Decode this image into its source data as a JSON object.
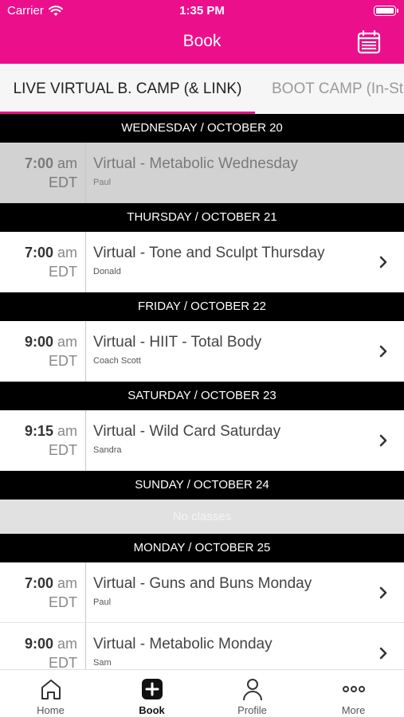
{
  "status_bar": {
    "carrier": "Carrier",
    "time": "1:35 PM"
  },
  "header": {
    "title": "Book",
    "calendar_icon": "calendar-icon"
  },
  "tabs": [
    {
      "label": "LIVE VIRTUAL B. CAMP (& LINK)",
      "active": true
    },
    {
      "label": "BOOT CAMP (In-St",
      "active": false
    }
  ],
  "days": [
    {
      "header": "WEDNESDAY / OCTOBER 20",
      "classes": [
        {
          "time": "7:00",
          "ampm": "am",
          "tz": "EDT",
          "name": "Virtual - Metabolic Wednesday",
          "instructor": "Paul"
        }
      ]
    },
    {
      "header": "THURSDAY / OCTOBER 21",
      "classes": [
        {
          "time": "7:00",
          "ampm": "am",
          "tz": "EDT",
          "name": "Virtual - Tone and Sculpt Thursday",
          "instructor": "Donald"
        }
      ]
    },
    {
      "header": "FRIDAY / OCTOBER 22",
      "classes": [
        {
          "time": "9:00",
          "ampm": "am",
          "tz": "EDT",
          "name": "Virtual - HIIT - Total Body",
          "instructor": "Coach Scott"
        }
      ]
    },
    {
      "header": "SATURDAY / OCTOBER 23",
      "classes": [
        {
          "time": "9:15",
          "ampm": "am",
          "tz": "EDT",
          "name": "Virtual - Wild Card Saturday",
          "instructor": "Sandra"
        }
      ]
    },
    {
      "header": "SUNDAY / OCTOBER 24",
      "empty_text": "No classes"
    },
    {
      "header": "MONDAY / OCTOBER 25",
      "classes": [
        {
          "time": "7:00",
          "ampm": "am",
          "tz": "EDT",
          "name": "Virtual - Guns and Buns Monday",
          "instructor": "Paul"
        },
        {
          "time": "9:00",
          "ampm": "am",
          "tz": "EDT",
          "name": "Virtual - Metabolic Monday",
          "instructor": "Sam"
        }
      ]
    }
  ],
  "tab_bar": [
    {
      "label": "Home",
      "icon": "home-icon"
    },
    {
      "label": "Book",
      "icon": "plus-icon"
    },
    {
      "label": "Profile",
      "icon": "person-icon"
    },
    {
      "label": "More",
      "icon": "more-icon"
    }
  ],
  "colors": {
    "brand": "#ec0f8c",
    "day_header": "#000000",
    "past_row": "#d2d2d2"
  }
}
